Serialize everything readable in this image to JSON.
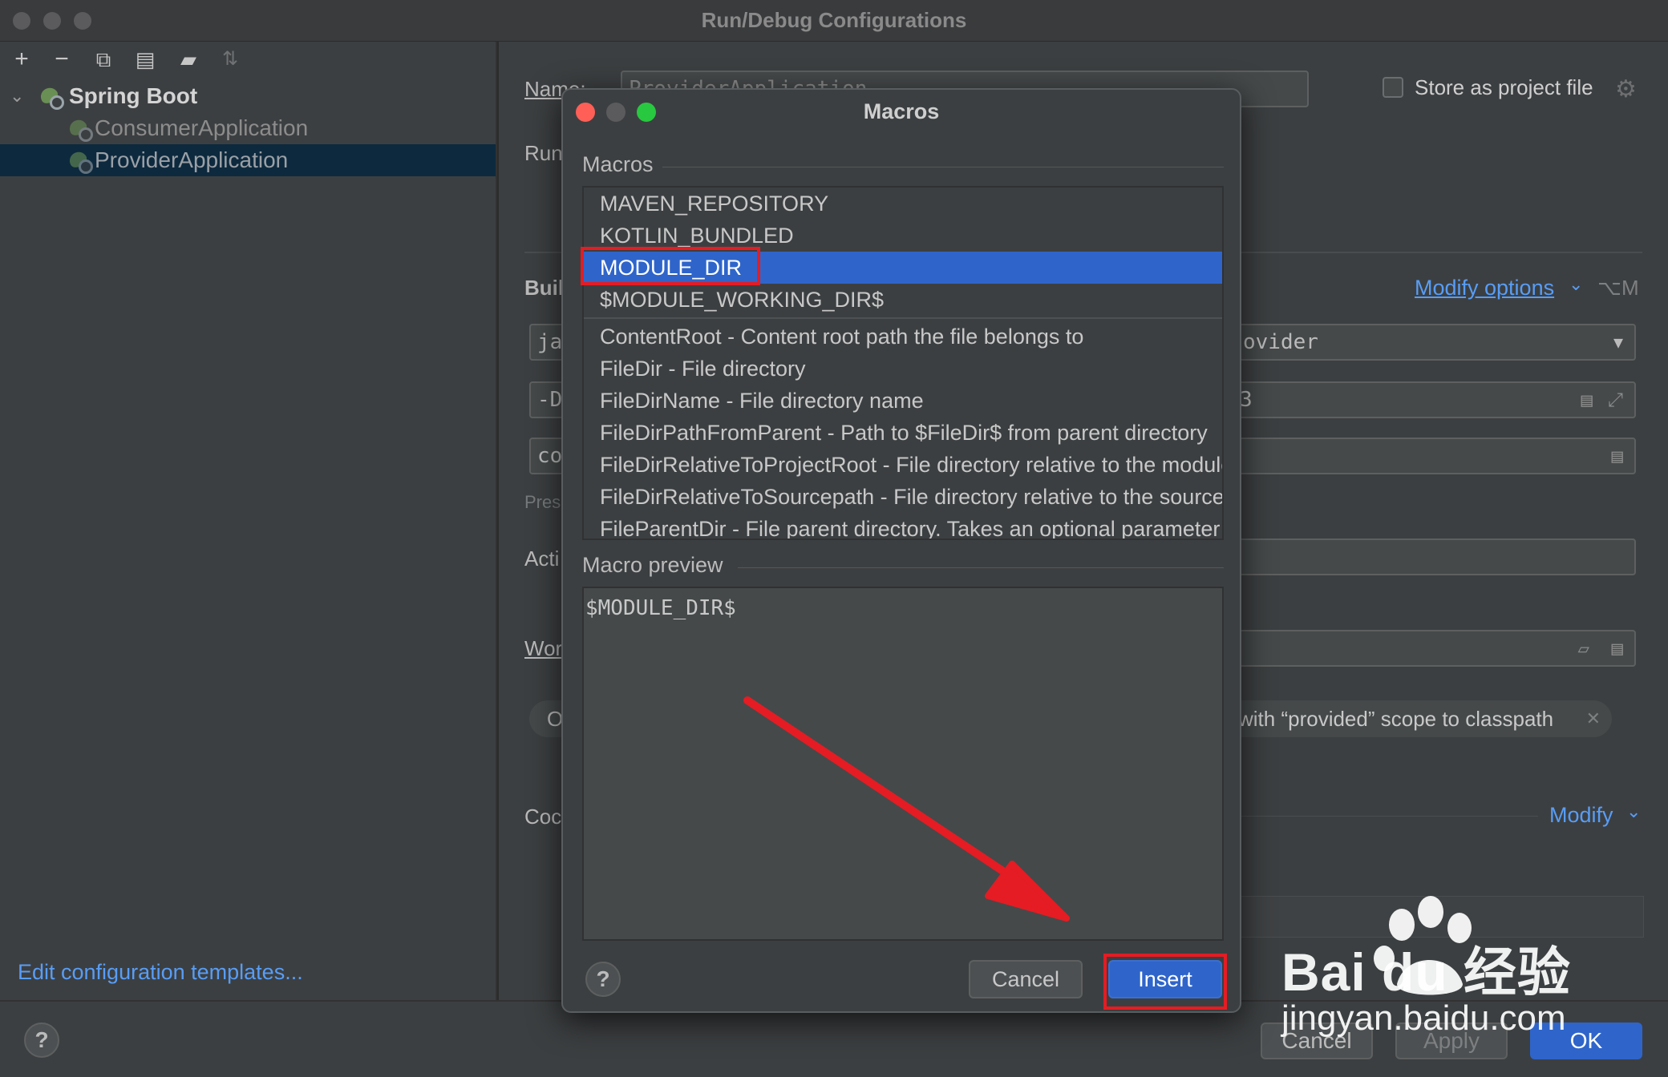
{
  "window": {
    "title": "Run/Debug Configurations"
  },
  "sidebar": {
    "tree": {
      "group_label": "Spring Boot",
      "items": [
        {
          "label": "ConsumerApplication",
          "selected": false
        },
        {
          "label": "ProviderApplication",
          "selected": true
        }
      ]
    },
    "edit_templates_link": "Edit configuration templates..."
  },
  "config": {
    "name_label": "Name:",
    "name_value": "ProviderApplication",
    "run_label": "Run",
    "store_checkbox_label": "Store as project file",
    "build_label": "Build",
    "modify_options_label": "Modify options",
    "modify_options_shortcut": "⌥M",
    "java_field_partial": "ja",
    "module_dropdown_value": "ovider",
    "vm_field_partial": "-D",
    "vm_field_tail": "3",
    "main_field_partial": "co",
    "press_hint_partial": "Pres",
    "active_label_partial": "Acti",
    "working_dir_label_partial": "Wor",
    "chip_partial": "O",
    "chip_text": "with “provided” scope to classpath",
    "code_label_partial": "Coc",
    "modify_label": "Modify"
  },
  "bottom_buttons": {
    "cancel": "Cancel",
    "apply": "Apply",
    "ok": "OK"
  },
  "help_symbol": "?",
  "dialog": {
    "title": "Macros",
    "macros_section_label": "Macros",
    "macros": [
      {
        "label": "MAVEN_REPOSITORY",
        "selected": false
      },
      {
        "label": "KOTLIN_BUNDLED",
        "selected": false
      },
      {
        "label": "MODULE_DIR",
        "selected": true
      },
      {
        "label": "$MODULE_WORKING_DIR$",
        "selected": false
      },
      {
        "label": "ContentRoot - Content root path the file belongs to",
        "selected": false
      },
      {
        "label": "FileDir - File directory",
        "selected": false
      },
      {
        "label": "FileDirName - File directory name",
        "selected": false
      },
      {
        "label": "FileDirPathFromParent - Path to $FileDir$ from parent directory",
        "selected": false
      },
      {
        "label": "FileDirRelativeToProjectRoot - File directory relative to the module",
        "selected": false
      },
      {
        "label": "FileDirRelativeToSourcepath - File directory relative to the sourcepath",
        "selected": false
      },
      {
        "label": "FileParentDir - File parent directory. Takes an optional parameter",
        "selected": false
      }
    ],
    "preview_section_label": "Macro preview",
    "preview_value": "$MODULE_DIR$",
    "cancel_label": "Cancel",
    "insert_label": "Insert"
  },
  "watermark": {
    "brand": "Bai du 经验",
    "url": "jingyan.baidu.com"
  },
  "colors": {
    "selection": "#2f65ca",
    "accent_link": "#589df6",
    "annotation_red": "#e51c23"
  }
}
